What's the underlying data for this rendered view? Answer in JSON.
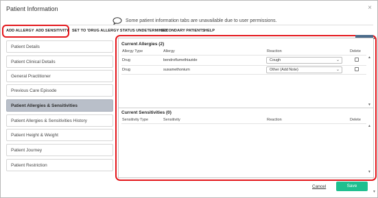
{
  "dialog": {
    "title": "Patient Information",
    "close_glyph": "×",
    "info_text": "Some patient information tabs are unavailable due to user permissions.",
    "info_icon": "speech-bubble-icon"
  },
  "toolbar": {
    "add_allergy": "ADD ALLERGY",
    "add_sensitivity": "ADD SENSITIVITY",
    "set_status": "SET TO 'DRUG ALLERGY STATUS UNDETERMINED'",
    "secondary_patients": "SECONDARY PATIENTS",
    "help": "HELP"
  },
  "sidebar": {
    "items": [
      {
        "label": "Patient Details",
        "active": false
      },
      {
        "label": "Patient Clinical Details",
        "active": false
      },
      {
        "label": "General Practitioner",
        "active": false
      },
      {
        "label": "Previous Care Episode",
        "active": false
      },
      {
        "label": "Patient Allergies & Sensitivities",
        "active": true
      },
      {
        "label": "Patient Allergies & Sensitivities History",
        "active": false
      },
      {
        "label": "Patient Height & Weight",
        "active": false
      },
      {
        "label": "Patient Journey",
        "active": false
      },
      {
        "label": "Patient Restriction",
        "active": false
      }
    ]
  },
  "allergies": {
    "title": "Current Allergies (2)",
    "headers": [
      "Allergy Type",
      "Allergy",
      "Reaction",
      "Delete"
    ],
    "rows": [
      {
        "type": "Drug",
        "allergy": "bendroflumethiazide",
        "reaction": "Cough"
      },
      {
        "type": "Drug",
        "allergy": "suxamethonium",
        "reaction": "Other (Add Note)"
      }
    ]
  },
  "sensitivities": {
    "title": "Current Sensitivities (0)",
    "headers": [
      "Sensitivity Type",
      "Sensitivity",
      "Reaction",
      "Delete"
    ]
  },
  "footer": {
    "cancel": "Cancel",
    "save": "Save"
  },
  "colors": {
    "accent_green": "#1fbf8f",
    "highlight_red": "#e3151a",
    "active_item": "#b9bfc9"
  }
}
